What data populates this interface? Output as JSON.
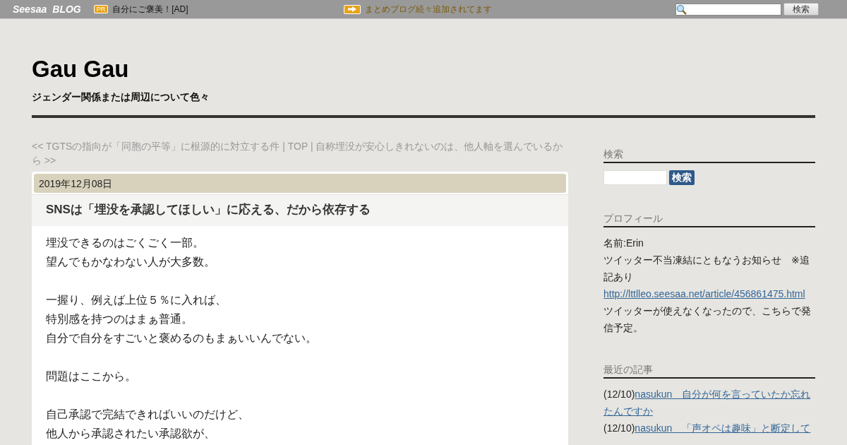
{
  "topbar": {
    "logo_left": "Seesaa",
    "logo_right": "BLOG",
    "pr_badge": "PR",
    "ad": "自分にご褒美！[AD]",
    "notice": "まとめブログ続々追加されてます",
    "search_button": "検索"
  },
  "header": {
    "title": "Gau Gau",
    "tagline": "ジェンダー関係または周辺について色々"
  },
  "post_nav": "<< TGTSの指向が「同胞の平等」に根源的に対立する件 | TOP | 自称埋没が安心しきれないのは、他人軸を選んでいるから >>",
  "article": {
    "date": "2019年12月08日",
    "title": "SNSは「埋没を承認してほしい」に応える、だから依存する",
    "paragraphs": [
      [
        "埋没できるのはごくごく一部。",
        "望んでもかなわない人が大多数。"
      ],
      [
        "一握り、例えば上位５％に入れば、",
        "特別感を持つのはまぁ普通。",
        "自分で自分をすごいと褒めるのもまぁいいんでない。"
      ],
      [
        "問題はここから。"
      ],
      [
        "自己承認で完結できればいいのだけど、",
        "他人から承認されたい承認欲が、"
      ]
    ]
  },
  "sidebar": [
    {
      "kind": "search",
      "heading": "検索",
      "button": "検索"
    },
    {
      "kind": "profile",
      "heading": "プロフィール",
      "items": [
        {
          "kind": "text",
          "text": "名前:Erin"
        },
        {
          "kind": "text",
          "text": "ツイッター不当凍結にともなうお知らせ　※追記あり"
        },
        {
          "kind": "link",
          "text": "http://lttlleo.seesaa.net/article/456861475.html"
        },
        {
          "kind": "text",
          "text": "ツイッターが使えなくなったので、こちらで発信予定。"
        }
      ]
    },
    {
      "kind": "recent",
      "heading": "最近の記事",
      "items": [
        {
          "date": "(12/10)",
          "title": "nasukun　自分が何を言っていたか忘れたんですか"
        },
        {
          "date": "(12/10)",
          "title": "nasukun　「声オペは趣味」と断定して"
        }
      ]
    }
  ]
}
